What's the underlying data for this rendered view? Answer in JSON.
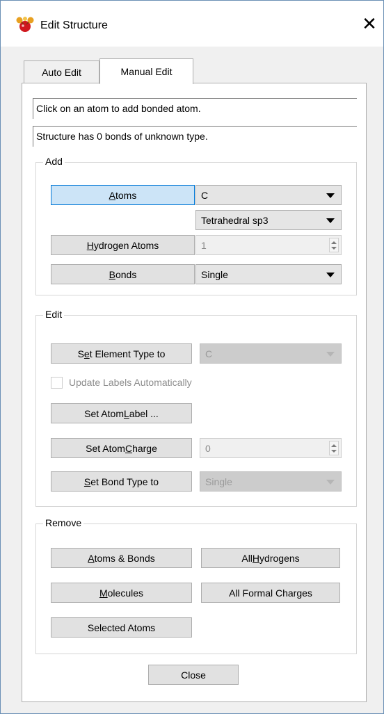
{
  "window": {
    "title": "Edit Structure",
    "close_glyph": "✕"
  },
  "tabs": [
    {
      "label": "Auto Edit",
      "selected": false
    },
    {
      "label": "Manual Edit",
      "selected": true
    }
  ],
  "messages": [
    "Click on an atom to add bonded atom.",
    "Structure has 0 bonds of unknown type."
  ],
  "add": {
    "group_label": "Add",
    "atoms_button": {
      "before": "",
      "mnemonic": "A",
      "after": "toms"
    },
    "element_value": "C",
    "geometry_value": "Tetrahedral sp3",
    "hydrogen_button": {
      "before": "",
      "mnemonic": "H",
      "after": "ydrogen Atoms"
    },
    "hydrogen_count": "1",
    "bonds_button": {
      "before": "",
      "mnemonic": "B",
      "after": "onds"
    },
    "bond_value": "Single"
  },
  "edit": {
    "group_label": "Edit",
    "set_element_button": {
      "before": "S",
      "mnemonic": "e",
      "after": "t Element Type to"
    },
    "element_value": "C",
    "update_labels_label": "Update Labels Automatically",
    "update_labels_checked": false,
    "set_label_button": {
      "before": "Set Atom ",
      "mnemonic": "L",
      "after": "abel ..."
    },
    "set_charge_button": {
      "before": "Set Atom ",
      "mnemonic": "C",
      "after": "harge"
    },
    "charge_value": "0",
    "set_bond_button": {
      "before": "",
      "mnemonic": "S",
      "after": "et Bond Type to"
    },
    "bond_value": "Single"
  },
  "remove": {
    "group_label": "Remove",
    "atoms_bonds_button": {
      "before": "",
      "mnemonic": "A",
      "after": "toms & Bonds"
    },
    "all_hydrogens_button": {
      "before": "All ",
      "mnemonic": "H",
      "after": "ydrogens"
    },
    "molecules_button": {
      "before": "",
      "mnemonic": "M",
      "after": "olecules"
    },
    "all_formal_charges_button": "All Formal Charges",
    "selected_atoms_button": "Selected Atoms"
  },
  "close_button": "Close",
  "colors": {
    "active_button": "#cce4f7",
    "active_border": "#0078d7",
    "icon_red": "#d0181f"
  }
}
